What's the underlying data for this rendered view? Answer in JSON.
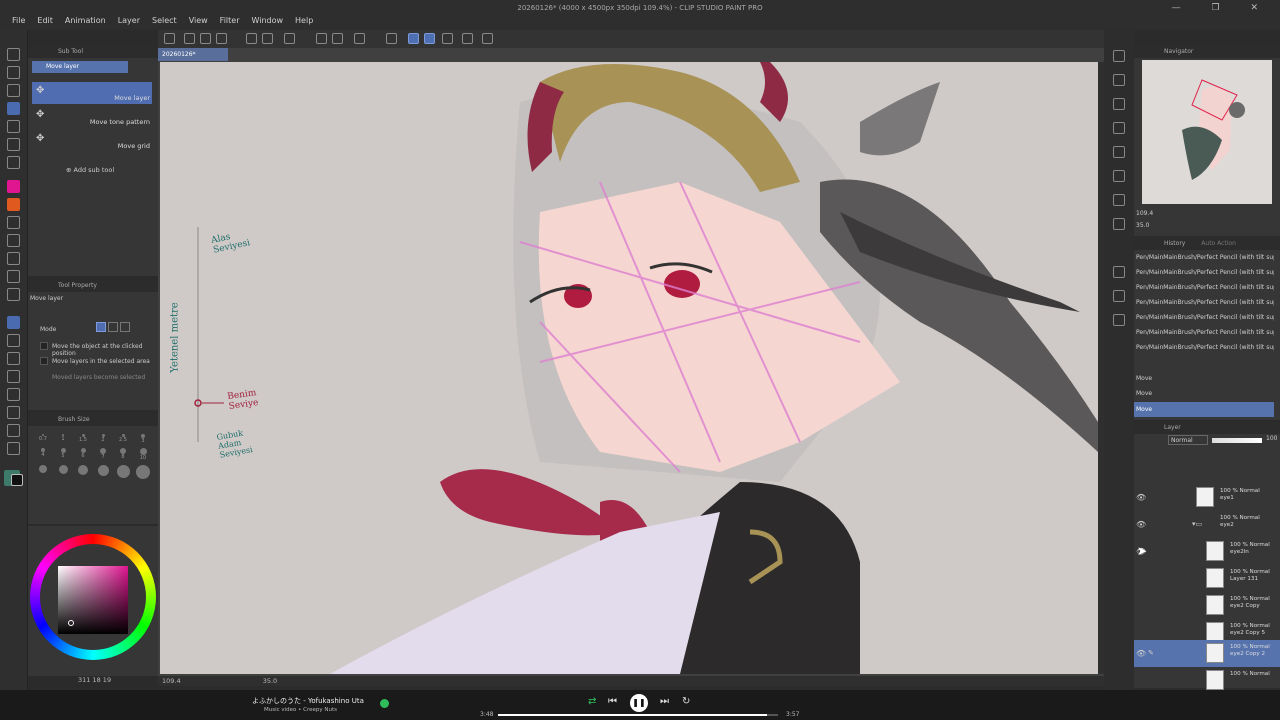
{
  "window": {
    "title": "20260126* (4000 x 4500px 350dpi 109.4%) - CLIP STUDIO PAINT PRO",
    "controls": "— ❐ ✕"
  },
  "menu": [
    "File",
    "Edit",
    "Animation",
    "Layer",
    "Select",
    "View",
    "Filter",
    "Window",
    "Help"
  ],
  "document": {
    "tab": "20260126*",
    "zoom": "109.4",
    "angle": "35.0"
  },
  "subtool": {
    "panel_title": "Sub Tool",
    "tab": "Move layer",
    "items": [
      "Move layer",
      "Move tone pattern",
      "Move grid"
    ],
    "add": "Add sub tool"
  },
  "tool_property": {
    "panel_title": "Tool Property",
    "tool_name": "Move layer",
    "mode_label": "Mode",
    "options": [
      {
        "label": "Move the object at the clicked position",
        "checked": false
      },
      {
        "label": "Move layers in the selected area",
        "checked": false
      },
      {
        "label": "Moved layers become selected",
        "checked": false
      }
    ]
  },
  "brush_size": {
    "panel_title": "Brush Size",
    "sizes": [
      "0.7",
      "1",
      "1.5",
      "2",
      "2.5",
      "3",
      "4",
      "5",
      "6",
      "7",
      "8",
      "10",
      "",
      "",
      "",
      "",
      "",
      ""
    ]
  },
  "color": {
    "main": "#e01590",
    "sub": "#3e7a6a",
    "status": "311  18  19"
  },
  "canvas_labels": {
    "top_label": "Alas\nSeviyesi",
    "side_label": "Yetenel metre",
    "mid_label": "Benim\nSeviye",
    "bottom_label": "Gubuk\nAdam\nSeviyesi"
  },
  "navigator": {
    "panel_title": "Navigator",
    "zoom": "109.4",
    "angle": "35.0"
  },
  "history": {
    "panel_title": "History",
    "tab2": "Auto Action",
    "items": [
      "Pen/MainMainBrush/Perfect Pencil (with tilt support)",
      "Pen/MainMainBrush/Perfect Pencil (with tilt support)",
      "Pen/MainMainBrush/Perfect Pencil (with tilt support)",
      "Pen/MainMainBrush/Perfect Pencil (with tilt support)",
      "Pen/MainMainBrush/Perfect Pencil (with tilt support)",
      "Pen/MainMainBrush/Perfect Pencil (with tilt support)",
      "Pen/MainMainBrush/Perfect Pencil (with tilt support)",
      "Move",
      "Move",
      "Move"
    ]
  },
  "layer": {
    "panel_title": "Layer",
    "blend": "Normal",
    "opacity": "100",
    "rows": [
      {
        "info": "100 % Normal",
        "name": "eye1"
      },
      {
        "info": "100 % Normal",
        "name": "eye2"
      },
      {
        "info": "100 % Normal",
        "name": "eye2ln"
      },
      {
        "info": "100 % Normal",
        "name": "Layer 131"
      },
      {
        "info": "100 % Normal",
        "name": "eye2 Copy"
      },
      {
        "info": "100 % Normal",
        "name": "eye2 Copy 5"
      },
      {
        "info": "100 % Normal",
        "name": "eye2 Copy 2"
      },
      {
        "info": "100 % Normal",
        "name": ""
      }
    ]
  },
  "media": {
    "song": "よふかしのうた - Yofukashino Uta",
    "artist": "Music video • Creepy Nuts",
    "elapsed": "3:48",
    "duration": "3:57",
    "progress": 0.96
  }
}
